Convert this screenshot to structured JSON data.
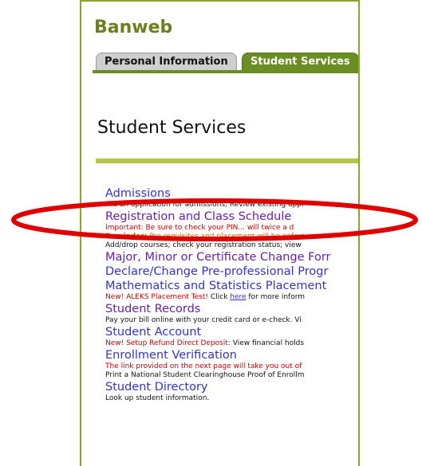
{
  "brand": "Banweb",
  "tabs": [
    {
      "label": "Personal Information",
      "active": false
    },
    {
      "label": "Student Services",
      "active": true
    }
  ],
  "page_title": "Student Services",
  "menu": {
    "admissions": {
      "label": "Admissions",
      "desc": "File an application for admissions; Review existing appl"
    },
    "registration": {
      "label": "Registration and Class Schedule",
      "important": "Important: Be sure to check your PIN... will twice a d",
      "reminder_bold": "Reminder:",
      "reminder_text": " Pre-requisites and placement will be enforc",
      "desc": "Add/drop courses; check your registration status; view"
    },
    "major": {
      "label": "Major, Minor or Certificate Change Forr"
    },
    "declare": {
      "label": "Declare/Change Pre-professional Progr"
    },
    "math": {
      "label": "Mathematics and Statistics Placement",
      "note_red": "New! ALEKS Placement Test!",
      "note_pre": " Click ",
      "note_link": "here",
      "note_post": " for more inform"
    },
    "records": {
      "label": "Student Records",
      "desc": "Pay your bill online with your credit card or e-check. Vi"
    },
    "account": {
      "label": "Student Account",
      "note_red": "New! Setup Refund Direct Deposit:",
      "note_post": " View financial holds"
    },
    "enrollment": {
      "label": "Enrollment Verification",
      "warn": "The link provided on the next page will take you out of",
      "desc": "Print a National Student Clearinghouse Proof of Enrollm"
    },
    "directory": {
      "label": "Student Directory",
      "desc": "Look up student information."
    }
  },
  "colors": {
    "brand": "#6b7f1e",
    "tab_active": "#6b8e23",
    "link": "#3333cc",
    "link_visited": "#6b1fa6",
    "warning": "#cc0000",
    "annotation_oval": "#e00000"
  }
}
